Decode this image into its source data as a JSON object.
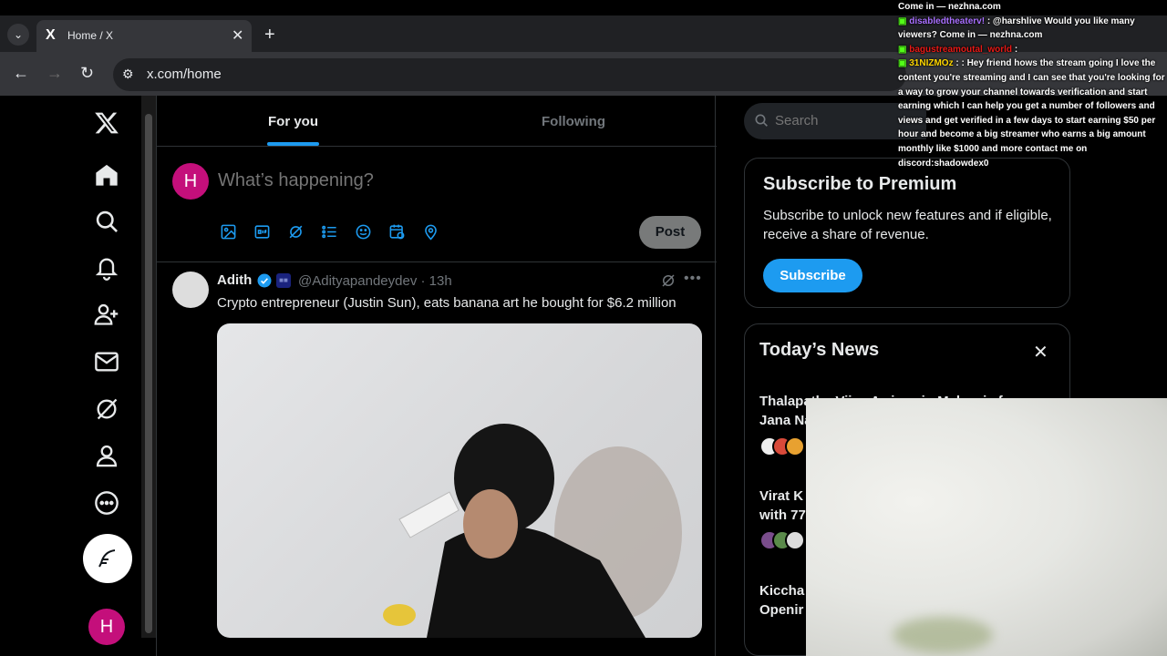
{
  "browser": {
    "tab_title": "Home / X",
    "tab_favicon": "X",
    "url": "x.com/home",
    "menu_icon": "⌄",
    "close_icon": "✕",
    "new_tab_icon": "+"
  },
  "nav": {
    "avatar_letter": "H",
    "icons": [
      "x-logo-icon",
      "home-icon",
      "search-icon",
      "notifications-icon",
      "follow-icon",
      "messages-icon",
      "grok-icon",
      "profile-icon",
      "more-icon",
      "compose-icon"
    ]
  },
  "timeline": {
    "tabs": [
      {
        "label": "For you"
      },
      {
        "label": "Following"
      }
    ],
    "composer": {
      "avatar_letter": "H",
      "placeholder": "What’s happening?",
      "post_label": "Post"
    },
    "tweet": {
      "name": "Adith",
      "handle_time": "@Adityapandeydev · 13h",
      "text": "Crypto entrepreneur (Justin Sun), eats banana art he bought for $6.2 million"
    }
  },
  "sidebar": {
    "search_placeholder": "Search",
    "premium": {
      "title": "Subscribe to Premium",
      "description": "Subscribe to unlock new features and if eligible, receive a share of revenue.",
      "button": "Subscribe"
    },
    "news": {
      "title": "Today’s News",
      "items": [
        {
          "line1": "Thalapathy Vijay Arrives in Malaysia for",
          "line2": "Jana Na"
        },
        {
          "line1": "Virat K",
          "line2": "with 77"
        },
        {
          "line1": "Kiccha",
          "line2": "Openir"
        }
      ]
    }
  },
  "chat": [
    {
      "user": "",
      "message": "Come in — nezhna.com"
    },
    {
      "user": "disabledtheaterv!",
      "message": ": @harshlive Would you like many viewers? Come in — nezhna.com"
    },
    {
      "user": "bagustreamoutal_world",
      "message": ":"
    },
    {
      "user": "31NIZMOz",
      "message": ": : Hey friend hows the stream going I love the content you're streaming and I can see that you're looking for a way to grow your channel towards verification and start earning which I can help you get a number of followers and views and get verified in a few days to start earning $50 per hour and become a big streamer who earns a big amount monthly like $1000 and more contact me on discord:shadowdex0"
    }
  ],
  "colors": {
    "accent": "#1d9bf0",
    "avatar": "#c40f7b",
    "kick_badge": "#53fc18"
  }
}
